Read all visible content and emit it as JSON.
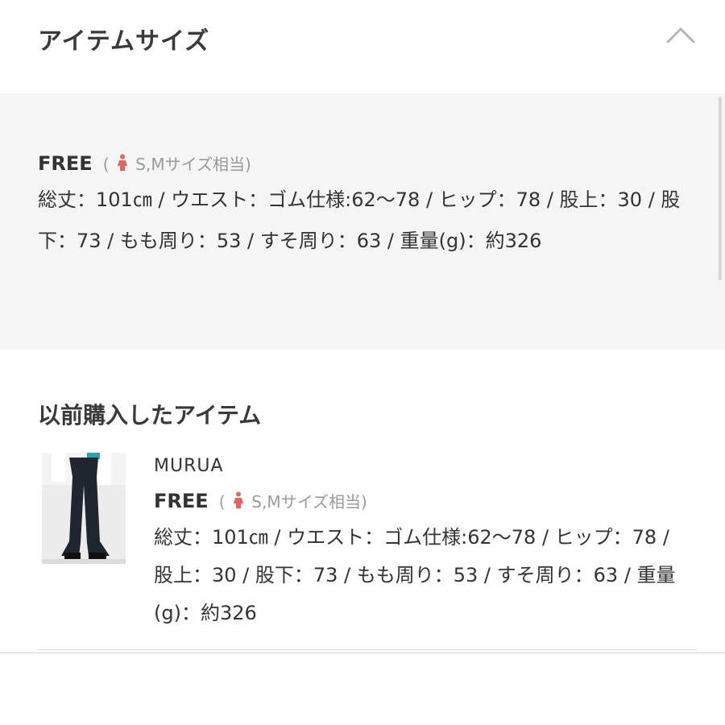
{
  "header": {
    "title": "アイテムサイズ"
  },
  "size": {
    "label": "FREE",
    "note_open": "(",
    "note_text": "S,Mサイズ相当)",
    "detail": "総丈：101㎝ / ウエスト：ゴム仕様:62～78 / ヒップ：78 / 股上：30 / 股下：73 / もも周り：53 / すそ周り：63 / 重量(g)：約326"
  },
  "purchased": {
    "title": "以前購入したアイテム",
    "items": [
      {
        "brand": "MURUA",
        "size_label": "FREE",
        "note_open": "(",
        "note_text": "S,Mサイズ相当)",
        "detail": "総丈：101㎝ / ウエスト：ゴム仕様:62～78 / ヒップ：78 / 股上：30 / 股下：73 / もも周り：53 / すそ周り：63 / 重量(g)：約326"
      }
    ]
  },
  "colors": {
    "accent_icon": "#e0645f",
    "section_bg": "#f5f5f5",
    "note_text": "#9a9a9a"
  },
  "icons": [
    "chevron-up-icon",
    "person-icon"
  ]
}
